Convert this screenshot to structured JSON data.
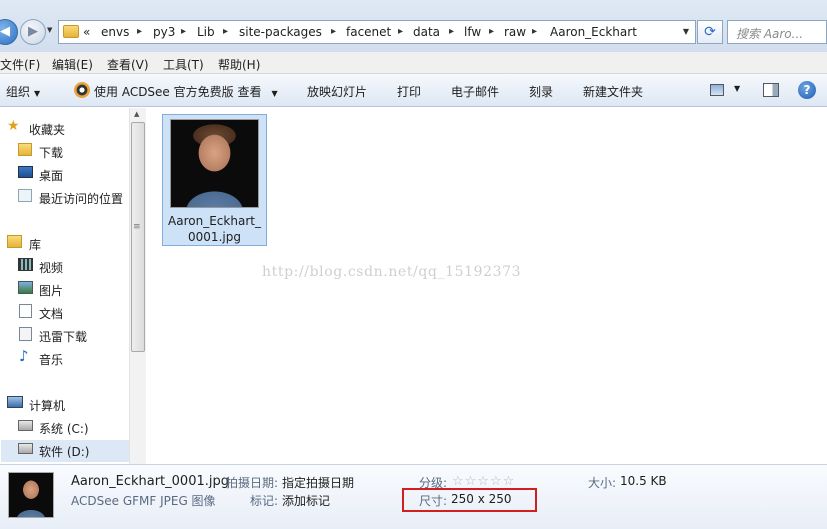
{
  "breadcrumb": {
    "overflow": "«",
    "items": [
      "envs",
      "py3",
      "Lib",
      "site-packages",
      "facenet",
      "data",
      "lfw",
      "raw",
      "Aaron_Eckhart"
    ]
  },
  "search": {
    "placeholder": "搜索 Aaro..."
  },
  "menu": {
    "items": [
      "文件(F)",
      "编辑(E)",
      "查看(V)",
      "工具(T)",
      "帮助(H)"
    ]
  },
  "toolbar": {
    "organize": "组织",
    "acdsee": "使用 ACDSee 官方免费版 查看",
    "slideshow": "放映幻灯片",
    "print": "打印",
    "email": "电子邮件",
    "burn": "刻录",
    "new_folder": "新建文件夹",
    "help_glyph": "?"
  },
  "sidebar": {
    "favorites": "收藏夹",
    "download": "下载",
    "desktop": "桌面",
    "recent": "最近访问的位置",
    "libraries": "库",
    "videos": "视频",
    "pictures": "图片",
    "documents": "文档",
    "thunder": "迅雷下载",
    "music": "音乐",
    "computer": "计算机",
    "drive_c": "系统 (C:)",
    "drive_d": "软件 (D:)"
  },
  "file": {
    "name_line1": "Aaron_Eckhart_",
    "name_line2": "0001.jpg"
  },
  "watermark": "http://blog.csdn.net/qq_15192373",
  "details": {
    "filename": "Aaron_Eckhart_0001.jpg",
    "type": "ACDSee GFMF JPEG 图像",
    "date_label": "拍摄日期:",
    "date_value": "指定拍摄日期",
    "tag_label": "标记:",
    "tag_value": "添加标记",
    "rating_label": "分级:",
    "rating_stars": "☆☆☆☆☆",
    "size_label": "大小:",
    "size_value": "10.5 KB",
    "dimension_label": "尺寸:",
    "dimension_value": "250 x 250"
  }
}
